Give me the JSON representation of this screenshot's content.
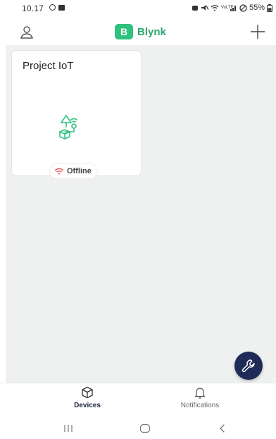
{
  "status_bar": {
    "time": "10.17",
    "battery": "55%",
    "network_label": "VoLTE"
  },
  "header": {
    "brand_letter": "B",
    "brand_name": "Blynk"
  },
  "devices": [
    {
      "name": "Project IoT",
      "status": "Offline"
    }
  ],
  "bottom_nav": {
    "items": [
      {
        "label": "Devices",
        "active": true
      },
      {
        "label": "Notifications",
        "active": false
      }
    ]
  },
  "colors": {
    "brand": "#2ec27e",
    "fab": "#1f2a57",
    "offline": "#e0474c",
    "content_bg": "#eef1f0"
  }
}
